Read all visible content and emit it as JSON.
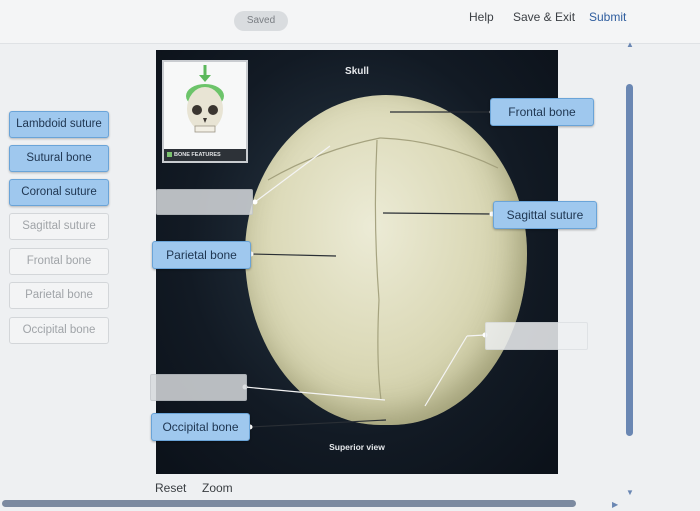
{
  "header": {
    "saved_status": "Saved",
    "help": "Help",
    "save_exit": "Save & Exit",
    "submit": "Submit"
  },
  "label_bank": [
    {
      "label": "Lambdoid suture",
      "state": "available"
    },
    {
      "label": "Sutural bone",
      "state": "available"
    },
    {
      "label": "Coronal suture",
      "state": "available"
    },
    {
      "label": "Sagittal suture",
      "state": "used"
    },
    {
      "label": "Frontal bone",
      "state": "used"
    },
    {
      "label": "Parietal bone",
      "state": "used"
    },
    {
      "label": "Occipital bone",
      "state": "used"
    }
  ],
  "figure": {
    "title": "Skull",
    "view": "Superior view",
    "thumbnail_caption": "BONE FEATURES"
  },
  "placed_labels": {
    "frontal": "Frontal bone",
    "sagittal": "Sagittal suture",
    "parietal": "Parietal bone",
    "occipital": "Occipital bone"
  },
  "controls": {
    "reset": "Reset",
    "zoom": "Zoom"
  },
  "colors": {
    "label_fill": "#9fc8ee",
    "label_border": "#6aa4d8",
    "scrollbar": "#6a87b3",
    "panel_bg": "#121a24"
  }
}
